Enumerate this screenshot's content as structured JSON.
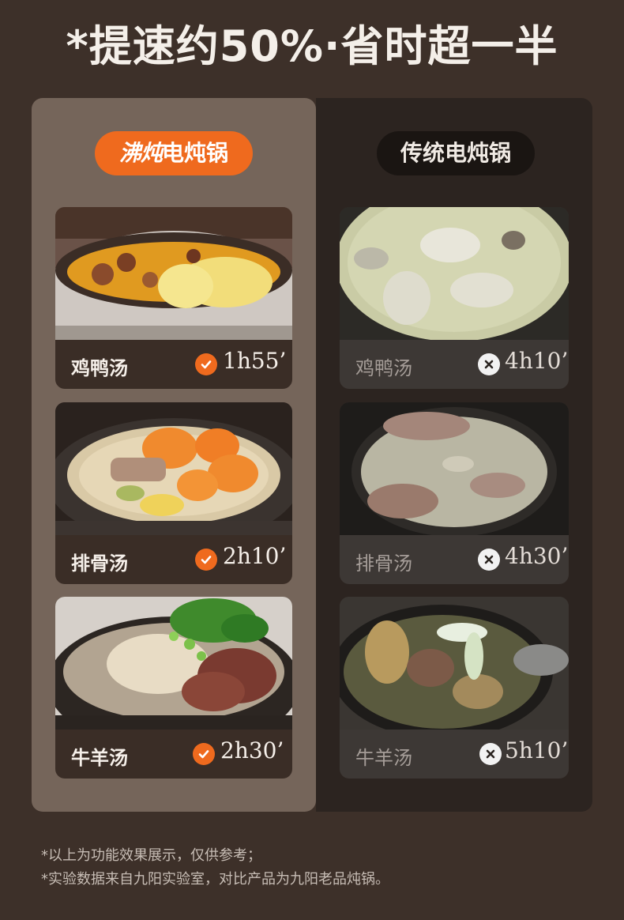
{
  "headline": "*提速约50%·省时超一半",
  "left_column": {
    "brand": "沸炖",
    "product": "电炖锅",
    "items": [
      {
        "name": "鸡鸭汤",
        "time": "1h55’",
        "status": "check-icon"
      },
      {
        "name": "排骨汤",
        "time": "2h10’",
        "status": "check-icon"
      },
      {
        "name": "牛羊汤",
        "time": "2h30’",
        "status": "check-icon"
      }
    ]
  },
  "right_column": {
    "title": "传统电炖锅",
    "items": [
      {
        "name": "鸡鸭汤",
        "time": "4h10’",
        "status": "cross-icon"
      },
      {
        "name": "排骨汤",
        "time": "4h30’",
        "status": "cross-icon"
      },
      {
        "name": "牛羊汤",
        "time": "5h10’",
        "status": "cross-icon"
      }
    ]
  },
  "footnotes": [
    "*以上为功能效果展示，仅供参考；",
    "*实验数据来自九阳实验室，对比产品为九阳老品炖锅。"
  ],
  "colors": {
    "accent": "#ef6a1e",
    "background": "#3d3029",
    "left_panel": "#75655a",
    "right_panel": "#2c2420"
  }
}
